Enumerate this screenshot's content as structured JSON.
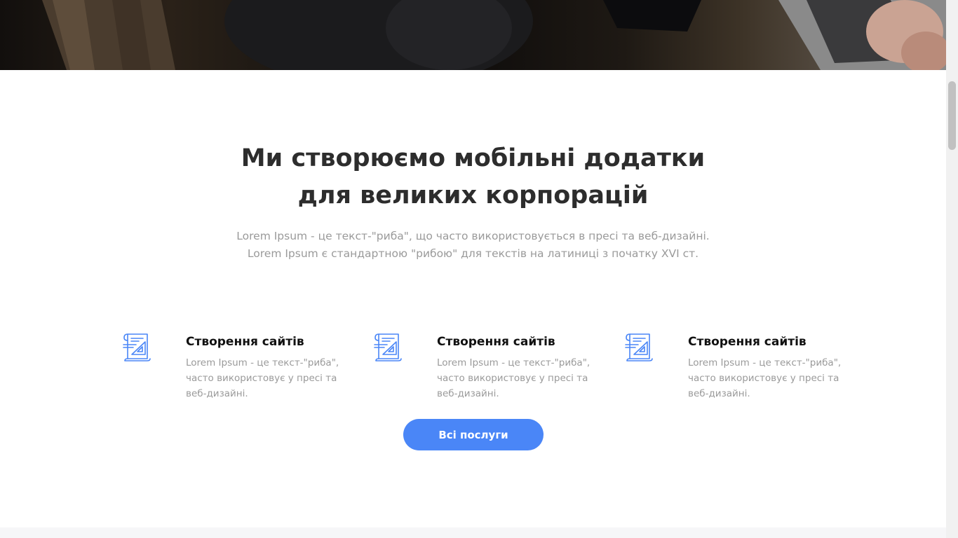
{
  "colors": {
    "accent": "#4a86f7",
    "heading": "#2d2d2d",
    "muted_text": "#9a9a9a",
    "background": "#ffffff"
  },
  "hero": {
    "image": "photo of people working at laptops on a wooden table"
  },
  "intro": {
    "title": "Ми створюємо мобільні додатки для великих корпорацій",
    "lead": [
      "Lorem Ipsum - це текст-\"риба\", що часто використовується в пресі та веб-дизайні.",
      "Lorem Ipsum є стандартною \"рибою\" для текстів на латиниці з початку XVI ст."
    ]
  },
  "services": [
    {
      "icon": "blueprint-icon",
      "title": "Створення сайтів",
      "text": "Lorem Ipsum - це текст-\"риба\", часто використовує у пресі та веб-дизайні."
    },
    {
      "icon": "blueprint-icon",
      "title": "Створення сайтів",
      "text": "Lorem Ipsum - це текст-\"риба\", часто використовує у пресі та веб-дизайні."
    },
    {
      "icon": "blueprint-icon",
      "title": "Створення сайтів",
      "text": "Lorem Ipsum - це текст-\"риба\", часто використовує у пресі та веб-дизайні."
    }
  ],
  "cta": {
    "label": "Всі послуги"
  }
}
